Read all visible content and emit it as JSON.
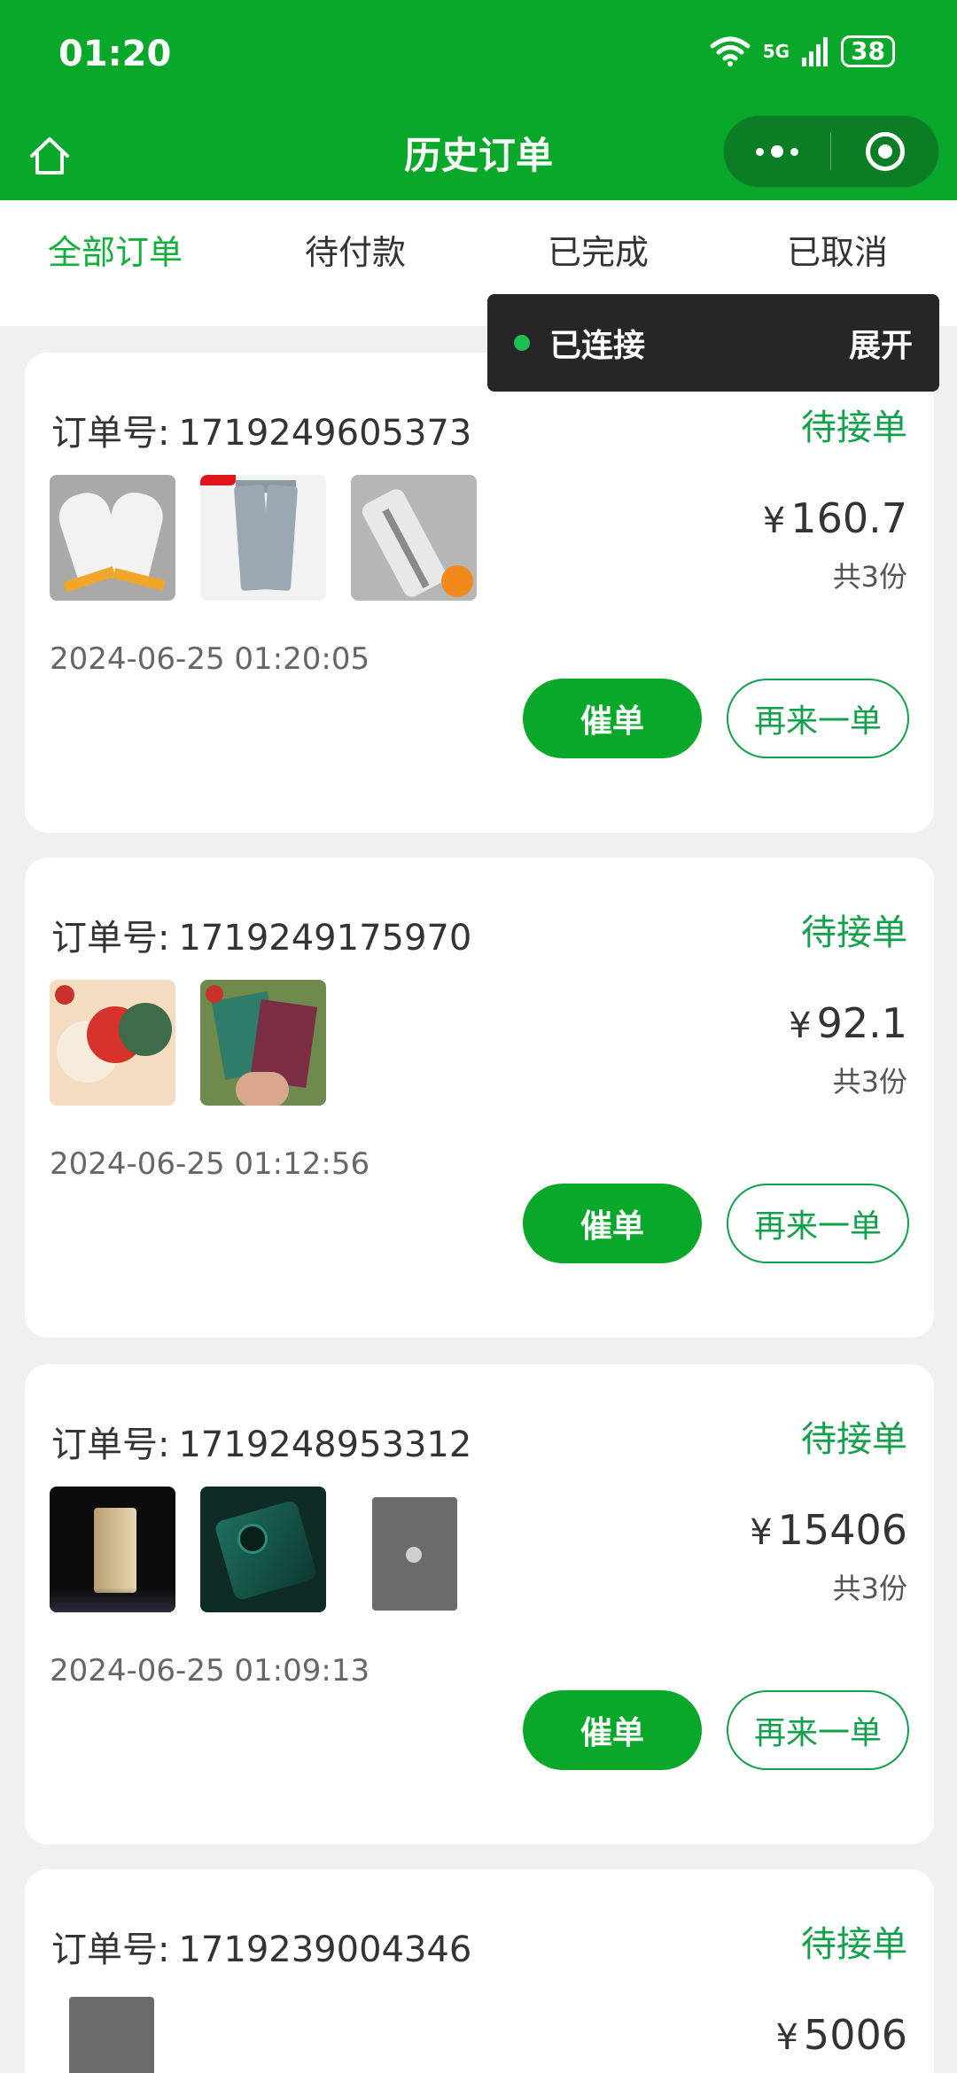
{
  "status": {
    "time": "01:20",
    "network": "5G",
    "battery": "38"
  },
  "nav": {
    "title": "历史订单"
  },
  "tabs": [
    {
      "label": "全部订单",
      "active": true
    },
    {
      "label": "待付款",
      "active": false
    },
    {
      "label": "已完成",
      "active": false
    },
    {
      "label": "已取消",
      "active": false
    }
  ],
  "toast": {
    "label": "已连接",
    "action": "展开"
  },
  "colors": {
    "brand": "#0aa82a",
    "accent_text": "#12a04a",
    "active_tab": "#12b03a"
  },
  "order_no_label": "订单号:",
  "orders": [
    {
      "number": "1719249605373",
      "status": "待接单",
      "price": "160.7",
      "currency": "¥",
      "quantity": "共3份",
      "date": "2024-06-25 01:20:05",
      "urge_label": "催单",
      "again_label": "再来一单",
      "thumbs": [
        "gloves",
        "pants",
        "pen"
      ]
    },
    {
      "number": "1719249175970",
      "status": "待接单",
      "price": "92.1",
      "currency": "¥",
      "quantity": "共3份",
      "date": "2024-06-25 01:12:56",
      "urge_label": "催单",
      "again_label": "再来一单",
      "thumbs": [
        "coasters",
        "notebooks"
      ]
    },
    {
      "number": "1719248953312",
      "status": "待接单",
      "price": "15406",
      "currency": "¥",
      "quantity": "共3份",
      "date": "2024-06-25 01:09:13",
      "urge_label": "催单",
      "again_label": "再来一单",
      "thumbs": [
        "phone-gold",
        "phone-green",
        "ipad"
      ]
    },
    {
      "number": "1719239004346",
      "status": "待接单",
      "price": "5006",
      "currency": "¥",
      "thumbs": [
        "ipad"
      ]
    }
  ]
}
